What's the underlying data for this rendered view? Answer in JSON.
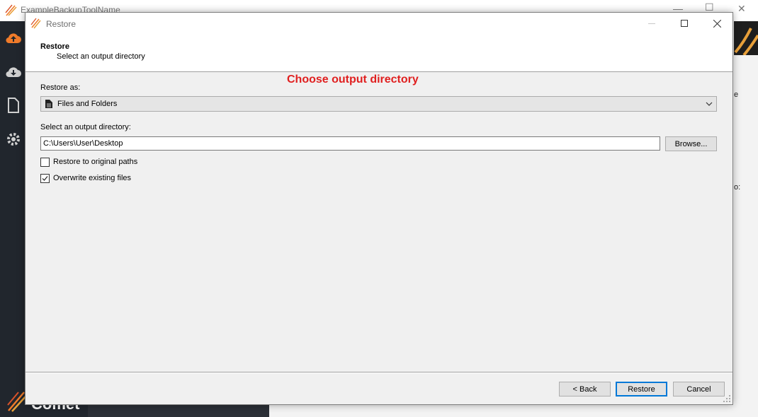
{
  "background_app": {
    "title": "ExampleBackupToolName",
    "brand": "Comet",
    "right_fragments": [
      "e",
      "o:"
    ]
  },
  "dialog": {
    "title": "Restore",
    "header": {
      "title": "Restore",
      "subtitle": "Select an output directory"
    },
    "annotation": "Choose output directory",
    "restore_as": {
      "label": "Restore as:",
      "selected": "Files and Folders",
      "icon": "document-icon"
    },
    "output_dir": {
      "label": "Select an output directory:",
      "value": "C:\\Users\\User\\Desktop",
      "browse_label": "Browse..."
    },
    "options": [
      {
        "label": "Restore to original paths",
        "checked": false
      },
      {
        "label": "Overwrite existing files",
        "checked": true
      }
    ],
    "buttons": {
      "back": "< Back",
      "restore": "Restore",
      "cancel": "Cancel"
    }
  },
  "colors": {
    "annotation": "#e02020",
    "sidebar": "#21262d",
    "accent_orange": "#f07b2a",
    "primary_border": "#0078d7"
  }
}
